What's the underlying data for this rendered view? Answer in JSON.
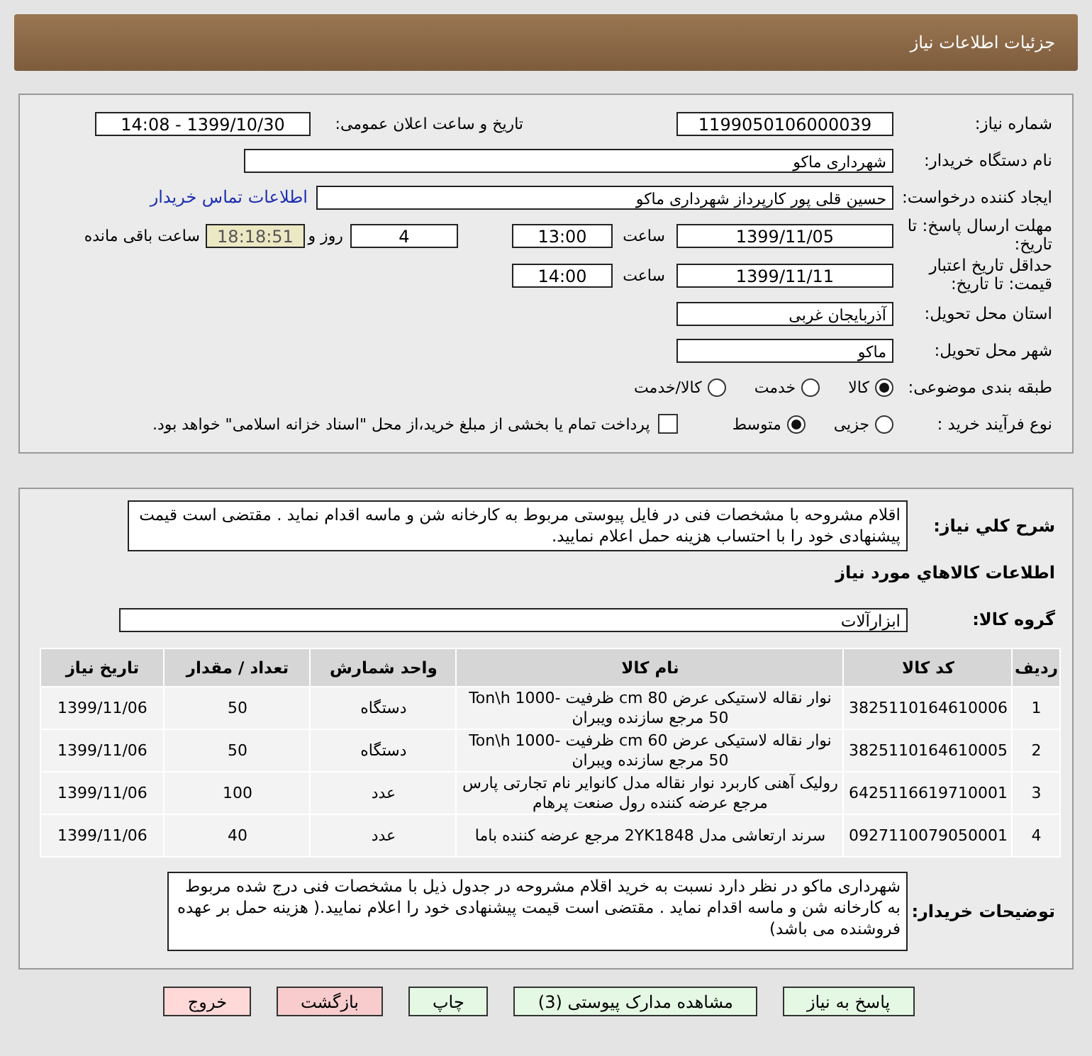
{
  "header": {
    "title": "جزئیات اطلاعات نیاز"
  },
  "details": {
    "need_number": {
      "label": "شماره نیاز:",
      "value": "1199050106000039"
    },
    "announce": {
      "label": "تاریخ و ساعت اعلان عمومی:",
      "value": "1399/10/30 - 14:08"
    },
    "buyer": {
      "label": "نام دستگاه خریدار:",
      "value": "شهرداری ماکو"
    },
    "creator": {
      "label": "ایجاد کننده درخواست:",
      "value": "حسین قلی پور کارپرداز شهرداری ماکو",
      "link": "اطلاعات تماس خریدار"
    },
    "deadline": {
      "label": "مهلت ارسال پاسخ: تا تاریخ:",
      "date": "1399/11/05",
      "time_label": "ساعت",
      "time": "13:00",
      "days": "4",
      "days_label": "روز و",
      "remaining": "18:18:51",
      "remaining_label": "ساعت باقی مانده"
    },
    "validity": {
      "label": "حداقل تاریخ اعتبار قیمت: تا تاریخ:",
      "date": "1399/11/11",
      "time_label": "ساعت",
      "time": "14:00"
    },
    "province": {
      "label": "استان محل تحویل:",
      "value": "آذربایجان غربی"
    },
    "city": {
      "label": "شهر محل تحویل:",
      "value": "ماکو"
    },
    "category": {
      "label": "طبقه بندی موضوعی:",
      "options": [
        {
          "label": "کالا",
          "selected": true
        },
        {
          "label": "خدمت",
          "selected": false
        },
        {
          "label": "کالا/خدمت",
          "selected": false
        }
      ]
    },
    "process": {
      "label": "نوع فرآیند خرید :",
      "options": [
        {
          "label": "جزیی",
          "selected": false
        },
        {
          "label": "متوسط",
          "selected": true
        }
      ],
      "payment": {
        "label": "پرداخت تمام یا بخشی از مبلغ خرید،از محل \"اسناد خزانه اسلامی\" خواهد بود.",
        "checked": false
      }
    }
  },
  "items": {
    "description": {
      "label": "شرح کلي نياز:",
      "value": "اقلام مشروحه با مشخصات فنی در فایل پیوستی مربوط به کارخانه شن و ماسه اقدام نماید . مقتضی است قیمت پیشنهادی خود را با احتساب هزینه حمل اعلام نمایید."
    },
    "heading": "اطلاعات کالاهاي مورد نياز",
    "group": {
      "label": "گروه کالا:",
      "value": "ابزارآلات"
    },
    "table": {
      "columns": [
        "ردیف",
        "کد کالا",
        "نام کالا",
        "واحد شمارش",
        "تعداد / مقدار",
        "تاریخ نیاز"
      ],
      "rows": [
        [
          "1",
          "3825110164610006",
          "نوار نقاله لاستیکی عرض cm 80 ظرفیت Ton\\h 1000-50 مرجع سازنده ویبران",
          "دستگاه",
          "50",
          "1399/11/06"
        ],
        [
          "2",
          "3825110164610005",
          "نوار نقاله لاستیکی عرض cm 60 ظرفیت Ton\\h 1000-50 مرجع سازنده ویبران",
          "دستگاه",
          "50",
          "1399/11/06"
        ],
        [
          "3",
          "6425116619710001",
          "رولیک آهنی کاربرد نوار نقاله مدل کانوایر نام تجارتی پارس مرجع عرضه کننده رول صنعت پرهام",
          "عدد",
          "100",
          "1399/11/06"
        ],
        [
          "4",
          "0927110079050001",
          "سرند ارتعاشی مدل 2YK1848 مرجع عرضه کننده باما",
          "عدد",
          "40",
          "1399/11/06"
        ]
      ]
    },
    "notes": {
      "label": "توضیحات خریدار:",
      "value": "شهرداری ماکو در نظر دارد نسبت به خرید اقلام مشروحه در جدول ذیل با مشخصات فنی درج شده مربوط به کارخانه شن و ماسه اقدام نماید . مقتضی است قیمت پیشنهادی خود را اعلام نمایید.( هزینه حمل بر عهده فروشنده می باشد)"
    }
  },
  "buttons": [
    {
      "label": "پاسخ به نیاز",
      "color": "#e4f8e4"
    },
    {
      "label": "مشاهده مدارک پیوستی (3)",
      "color": "#e4f8e4"
    },
    {
      "label": "چاپ",
      "color": "#e4f8e4"
    },
    {
      "label": "بازگشت",
      "color": "#f8cccc"
    },
    {
      "label": "خروج",
      "color": "#ffd8d8"
    }
  ]
}
